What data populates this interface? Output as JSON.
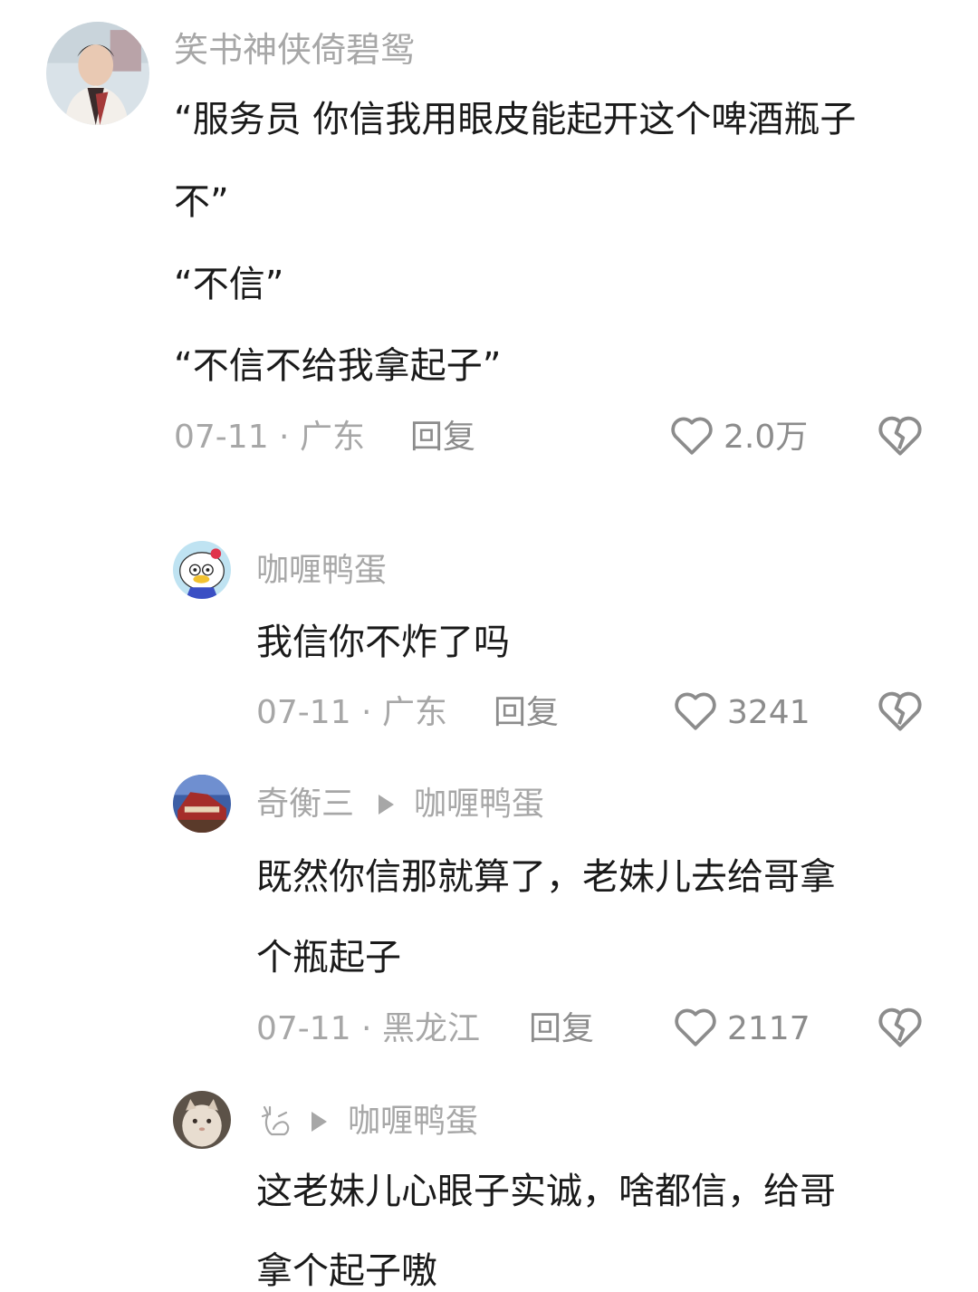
{
  "comments": [
    {
      "username": "笑书神侠倚碧鸳",
      "text_lines": [
        "“服务员 你信我用眼皮能起开这个啤酒瓶子",
        "不”",
        "“不信”",
        "“不信不给我拿起子”"
      ],
      "date_location": "07-11 · 广东",
      "reply_label": "回复",
      "likes": "2.0万"
    },
    {
      "username": "咖喱鸭蛋",
      "text_lines": [
        "我信你不炸了吗"
      ],
      "date_location": "07-11 · 广东",
      "reply_label": "回复",
      "likes": "3241"
    },
    {
      "username": "奇衡三",
      "reply_to": "咖喱鸭蛋",
      "text_lines": [
        "既然你信那就算了，老妹儿去给哥拿",
        "个瓶起子"
      ],
      "date_location": "07-11 · 黑龙江",
      "reply_label": "回复",
      "likes": "2117"
    },
    {
      "username": "",
      "reply_to": "咖喱鸭蛋",
      "text_lines": [
        "这老妹儿心眼子实诚，啥都信，给哥",
        "拿个起子嗷"
      ]
    }
  ],
  "icons": {
    "like": "heart-outline-icon",
    "dislike": "broken-heart-icon",
    "reply_arrow": "play-triangle-icon"
  },
  "colors": {
    "text": "#1a1a1a",
    "secondary": "#a7a7a7",
    "action": "#8c8c8c"
  }
}
